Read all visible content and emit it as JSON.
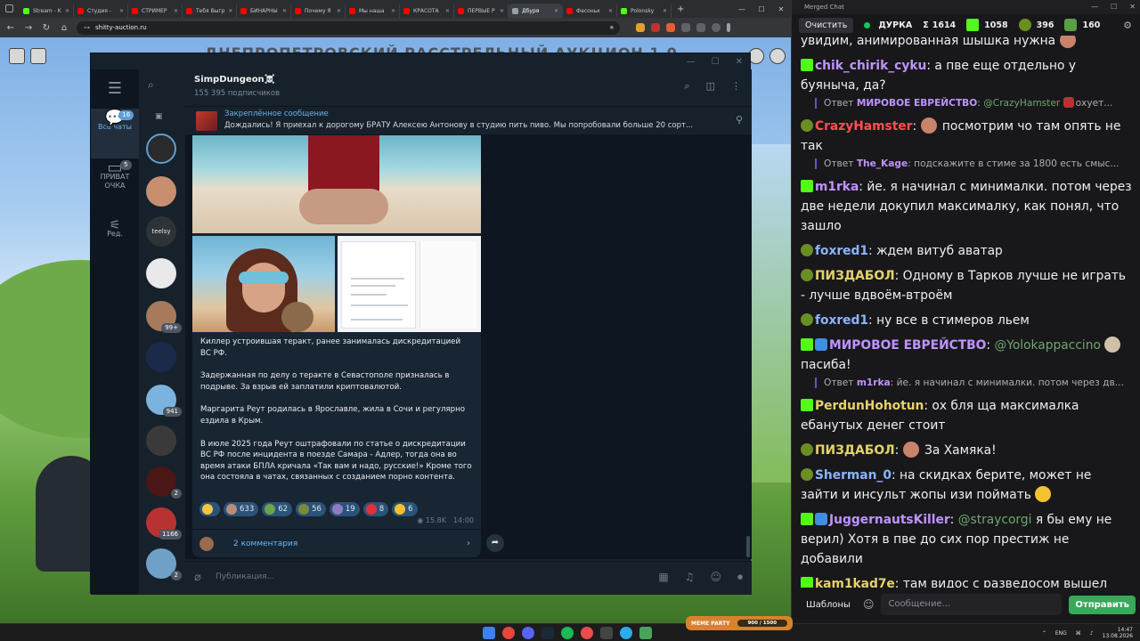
{
  "browser": {
    "tabs": [
      {
        "label": "Stream - K",
        "color": "#53fc18"
      },
      {
        "label": "Студия -",
        "color": "#ff0000"
      },
      {
        "label": "СТРИМЕР",
        "color": "#ff0000"
      },
      {
        "label": "Тебя Выгр",
        "color": "#ff0000"
      },
      {
        "label": "БИНАРНЫ",
        "color": "#ff0000"
      },
      {
        "label": "Почему Я",
        "color": "#ff0000"
      },
      {
        "label": "Мы наша",
        "color": "#ff0000"
      },
      {
        "label": "КРАСОТА",
        "color": "#ff0000"
      },
      {
        "label": "ПЕРВЫЕ Р",
        "color": "#ff0000"
      },
      {
        "label": "Дбуря",
        "color": "#9aa0a6",
        "active": true
      },
      {
        "label": "Фасоньк",
        "color": "#ff0000"
      },
      {
        "label": "Polonsky",
        "color": "#53fc18"
      }
    ],
    "url": "shitty-auction.ru",
    "page_banner": "ДНЕПРОПЕТРОВСКИЙ РАССТРЕЛЬНЫЙ АУКЦИОН 1.0"
  },
  "telegram": {
    "channel_name": "SimpDungeon☠️",
    "subscribers": "155 395 подписчиков",
    "rail": [
      {
        "label": "Все чаты",
        "badge": "16"
      },
      {
        "label": "ПРИВАТ ОЧКА",
        "badge": "5"
      },
      {
        "label": "Ред.",
        "badge": ""
      }
    ],
    "chat_badges": {
      "b5": "99+",
      "b7": "941",
      "b9": "2",
      "b10": "1166",
      "b11": "2"
    },
    "chat_label_teelsy": "teelsy",
    "pinned_label": "Закреплённое сообщение",
    "pinned_text": "Дождались! Я приехал к дорогому БРАТУ Алексею Антонову в студию пить пиво. Мы попробовали больше 20 сорт...",
    "post_paragraphs": [
      "Киллер устроившая теракт, ранее занималась дискредитацией ВС РФ.",
      "Задержанная по делу о теракте в Севастополе призналась в подрыве. За взрыв ей заплатили криптовалютой.",
      "Маргарита Реут родилась в Ярославле, жила в Сочи и регулярно ездила в Крым.",
      "В июле 2025 года Реут оштрафовали по статье о дискредитации ВС РФ после инцидента в поезде Самара - Адлер, тогда она во время атаки БПЛА кричала «Так вам и надо, русские!» Кроме того она состояла в чатах, связанных с созданием порно контента."
    ],
    "reactions": [
      {
        "count": "",
        "color": "#f5c542"
      },
      {
        "count": "633",
        "color": "#b98c7a"
      },
      {
        "count": "62",
        "color": "#6da34d"
      },
      {
        "count": "56",
        "color": "#7a8a3c"
      },
      {
        "count": "19",
        "color": "#8e7cc3"
      },
      {
        "count": "8",
        "color": "#e5303a"
      },
      {
        "count": "6",
        "color": "#f2c230"
      }
    ],
    "views": "15.8K",
    "time": "14:00",
    "comments_label": "2 комментария",
    "composer_placeholder": "Публикация..."
  },
  "chat": {
    "window_title": "Merged Chat",
    "clear_button": "Очистить",
    "channel": "ДУРКА",
    "stats": {
      "sigma": "1614",
      "kick": "1058",
      "pepe": "396",
      "cash": "160"
    },
    "top_partial": "увидим, анимированная шышка нужна",
    "messages": [
      {
        "user": "chik_chirik_cyku",
        "color": "#bf94ff",
        "icon": "k",
        "text": "а пве еще отдельно у буяныча, да?"
      },
      {
        "reply": true,
        "user": "МИРОВОЕ ЕВРЕЙСТВО",
        "mention": "@CrazyHamster",
        "text": "охует..."
      },
      {
        "user": "CrazyHamster",
        "color": "#ff4f4f",
        "icon": "pepe",
        "text": "посмотрим чо там опять не так",
        "emote": true
      },
      {
        "reply": true,
        "user": "The_Kage",
        "mention": "",
        "text": "подскажите в стиме за 1800 есть смыс..."
      },
      {
        "user": "m1rka",
        "color": "#bf94ff",
        "icon": "k",
        "text": "йе. я начинал с минималки. потом через две недели докупил максималку, как понял, что зашло"
      },
      {
        "user": "foxred1",
        "color": "#8cb4ff",
        "icon": "pepe",
        "text": "ждем витуб аватар"
      },
      {
        "user": "ПИЗДАБОЛ",
        "color": "#e6d36a",
        "icon": "pepe",
        "text": "Одному в Тарков лучше не играть - лучше вдвоём-втроём"
      },
      {
        "user": "foxred1",
        "color": "#8cb4ff",
        "icon": "pepe",
        "text": "ну все в стимеров льем"
      },
      {
        "user": "МИРОВОЕ ЕВРЕЙСТВО",
        "color": "#bf94ff",
        "icon": "kx",
        "mention": "@Yolokappaccino",
        "text": "пасиба!"
      },
      {
        "reply": true,
        "user": "m1rka",
        "mention": "",
        "text": "йе. я начинал с минималки. потом через дв..."
      },
      {
        "user": "PerdunHohotun",
        "color": "#e6d36a",
        "icon": "k",
        "text": "ох бля ща максималка ебанутых денег стоит"
      },
      {
        "user": "ПИЗДАБОЛ",
        "color": "#e6d36a",
        "icon": "pepe",
        "text": "За Хамяка!",
        "emote": true
      },
      {
        "user": "Sherman_0",
        "color": "#8cb4ff",
        "icon": "pepe",
        "text": "на скидках берите, может не зайти и инсульт жопы изи поймать"
      },
      {
        "user": "JuggernautsKiller",
        "color": "#bf94ff",
        "icon": "kx",
        "mention": "@straycorgi",
        "text": "я бы ему не верил) Хотя в пве до сих пор престиж не добавили"
      },
      {
        "user": "kam1kad7e",
        "color": "#e6d36a",
        "icon": "k",
        "text": "там видос с разведосом вышел"
      }
    ],
    "templates_button": "Шаблоны",
    "message_placeholder": "Сообщение...",
    "send_button": "Отправить"
  },
  "taskbar": {
    "widget_title": "MEME PARTY",
    "widget_progress": "900 / 1500",
    "lang": "ENG",
    "time": "14:47",
    "date": "13.08.2026"
  }
}
